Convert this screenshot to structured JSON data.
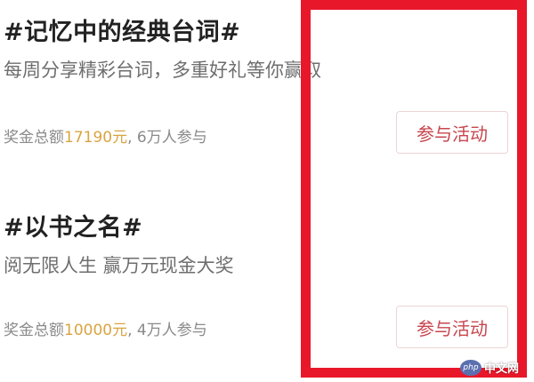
{
  "activities": [
    {
      "title": "#记忆中的经典台词#",
      "subtitle": "每周分享精彩台词，多重好礼等你赢取",
      "prize_prefix": "奖金总额",
      "prize_amount": "17190元",
      "participants": ", 6万人参与",
      "button_label": "参与活动"
    },
    {
      "title": "#以书之名#",
      "subtitle": "阅无限人生 赢万元现金大奖",
      "prize_prefix": "奖金总额",
      "prize_amount": "10000元",
      "participants": ", 4万人参与",
      "button_label": "参与活动"
    }
  ],
  "watermark": {
    "logo_text": "php",
    "text": "中文网"
  },
  "colors": {
    "highlight": "#e8182a",
    "amount": "#d9a441",
    "button_text": "#c8464e"
  }
}
